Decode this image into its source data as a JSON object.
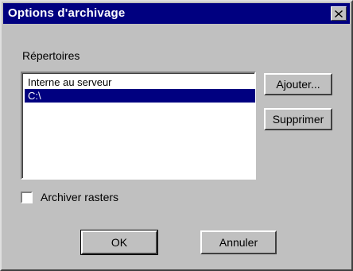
{
  "window": {
    "title": "Options d'archivage",
    "close_icon": "close-icon"
  },
  "directories": {
    "label": "Répertoires",
    "items": [
      {
        "label": "Interne au serveur",
        "selected": false
      },
      {
        "label": "C:\\",
        "selected": true
      }
    ]
  },
  "buttons": {
    "add": "Ajouter...",
    "remove": "Supprimer",
    "ok": "OK",
    "cancel": "Annuler"
  },
  "archive_rasters": {
    "label": "Archiver rasters",
    "checked": false
  },
  "colors": {
    "titlebar": "#000080",
    "face": "#c0c0c0",
    "selection": "#000080"
  }
}
